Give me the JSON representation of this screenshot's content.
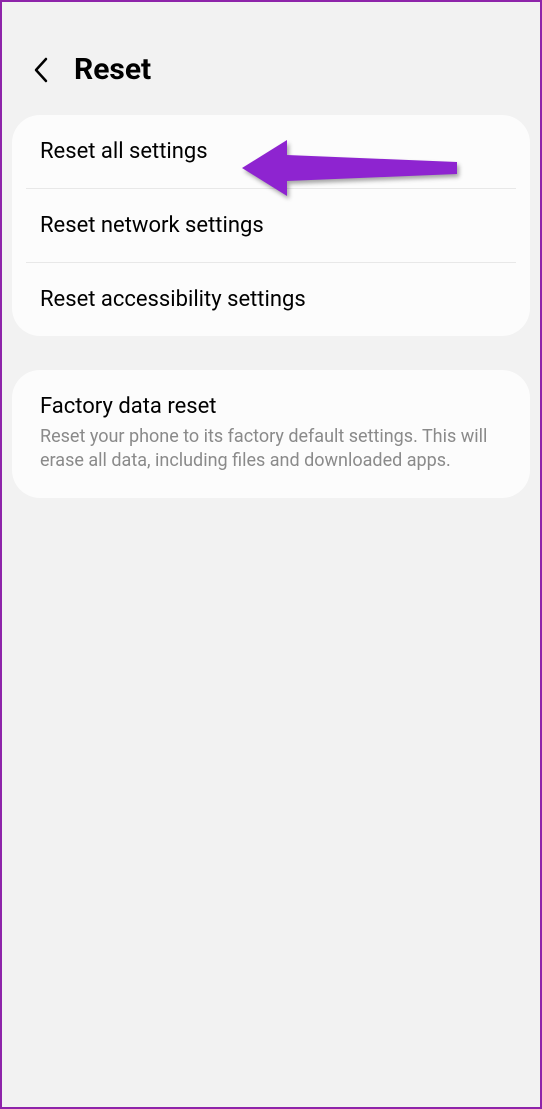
{
  "header": {
    "title": "Reset"
  },
  "group1": {
    "items": [
      {
        "label": "Reset all settings"
      },
      {
        "label": "Reset network settings"
      },
      {
        "label": "Reset accessibility settings"
      }
    ]
  },
  "group2": {
    "items": [
      {
        "label": "Factory data reset",
        "description": "Reset your phone to its factory default settings. This will erase all data, including files and downloaded apps."
      }
    ]
  }
}
